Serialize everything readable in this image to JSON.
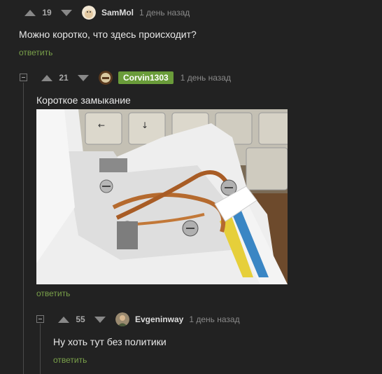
{
  "comments": [
    {
      "score": "19",
      "author": "SamMol",
      "time": "1 день назад",
      "text": "Можно коротко, что здесь происходит?",
      "reply": "ответить"
    },
    {
      "score": "21",
      "author": "Corvin1303",
      "time": "1 день назад",
      "text": "Короткое замыкание",
      "reply": "ответить",
      "badge_color": "#6a9c3a"
    },
    {
      "score": "55",
      "author": "Evgeninway",
      "time": "1 день назад",
      "text": "Ну хоть тут без политики",
      "reply": "ответить"
    }
  ],
  "colors": {
    "background": "#222222",
    "reply_link": "#7aa14a",
    "author_badge": "#6a9c3a"
  }
}
